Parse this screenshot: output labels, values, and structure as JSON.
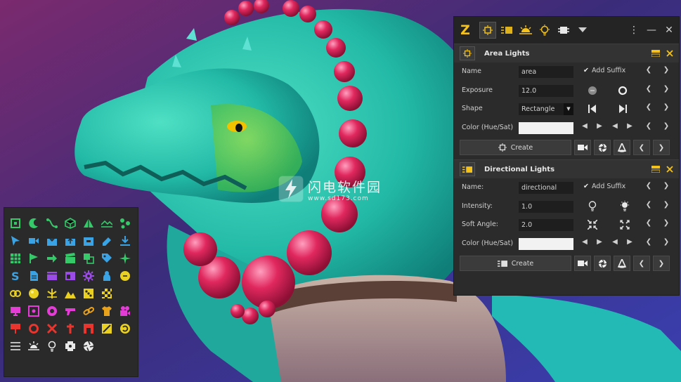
{
  "app": {
    "logo": "Z",
    "toolbar_icons": [
      "area-light-icon",
      "spot-light-icon",
      "sun-light-icon",
      "point-light-icon",
      "render-icon",
      "dropdown-arrow-icon"
    ],
    "window_controls": [
      "more-menu-icon",
      "minimize-icon",
      "close-icon"
    ]
  },
  "area_lights": {
    "title": "Area Lights",
    "name_label": "Name",
    "name_value": "area",
    "add_suffix": "Add Suffix",
    "exposure_label": "Exposure",
    "exposure_value": "12.0",
    "shape_label": "Shape",
    "shape_value": "Rectangle",
    "color_label": "Color (Hue/Sat)",
    "color_value": "#f2f2f2",
    "create_label": "Create"
  },
  "directional_lights": {
    "title": "Directional Lights",
    "name_label": "Name:",
    "name_value": "directional",
    "add_suffix": "Add Suffix",
    "intensity_label": "Intensity:",
    "intensity_value": "1.0",
    "soft_angle_label": "Soft Angle:",
    "soft_angle_value": "2.0",
    "color_label": "Color (Hue/Sat)",
    "color_value": "#f2f2f2",
    "create_label": "Create"
  },
  "watermark": {
    "text": "闪电软件园",
    "url": "www.sd173.com"
  },
  "colors": {
    "accent_yellow": "#f4c21b",
    "palette_green": "#35c96a",
    "palette_blue": "#3aa3e6",
    "palette_yellow": "#e9d021",
    "palette_magenta": "#e33dd6",
    "palette_red": "#e8352d"
  }
}
